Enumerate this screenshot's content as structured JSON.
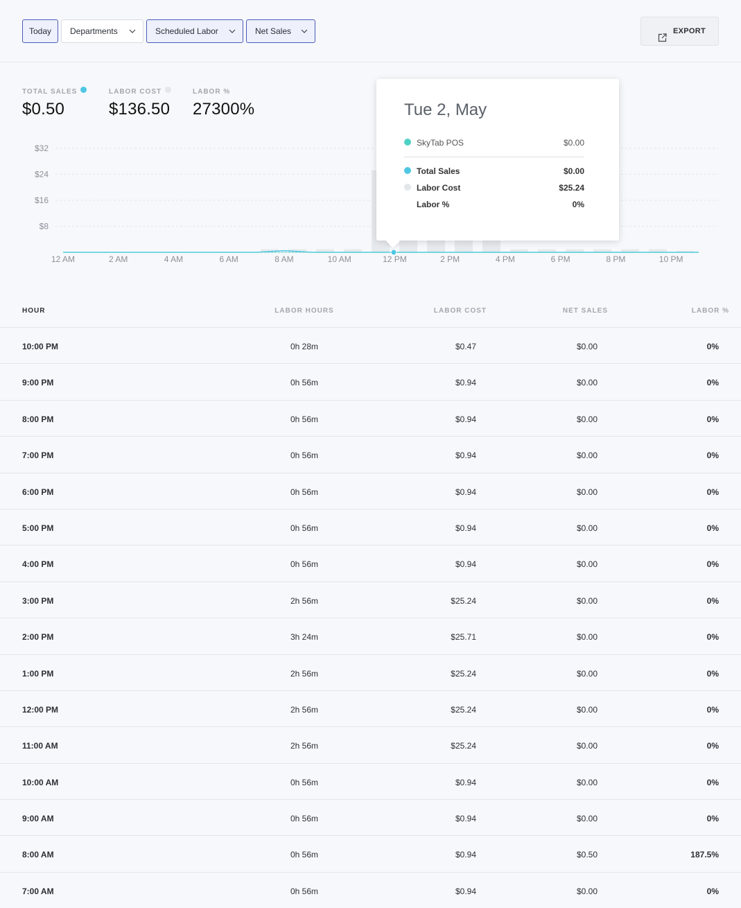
{
  "filters": {
    "today": "Today",
    "departments": "Departments",
    "scheduled_labor": "Scheduled Labor",
    "net_sales": "Net Sales"
  },
  "export_label": "EXPORT",
  "stats": {
    "total_sales": {
      "label": "TOTAL SALES",
      "value": "$0.50",
      "dot_color": "#4fc7e4"
    },
    "labor_cost": {
      "label": "LABOR COST",
      "value": "$136.50",
      "dot_color": "#e3e6ea"
    },
    "labor_pct": {
      "label": "LABOR %",
      "value": "27300%"
    }
  },
  "chart_data": {
    "type": "bar",
    "ylim": [
      0,
      32
    ],
    "ytick_labels": [
      "$32",
      "$24",
      "$16",
      "$8"
    ],
    "yticks": [
      32,
      24,
      16,
      8
    ],
    "xtick_labels": [
      "12 AM",
      "2 AM",
      "4 AM",
      "6 AM",
      "8 AM",
      "10 AM",
      "12 PM",
      "2 PM",
      "4 PM",
      "6 PM",
      "8 PM",
      "10 PM"
    ],
    "hours": [
      0,
      1,
      2,
      3,
      4,
      5,
      6,
      7,
      8,
      9,
      10,
      11,
      12,
      13,
      14,
      15,
      16,
      17,
      18,
      19,
      20,
      21,
      22,
      23
    ],
    "series": [
      {
        "name": "Labor Cost",
        "color": "#e6e9ed",
        "values": [
          0,
          0,
          0,
          0,
          0,
          0,
          0,
          0.94,
          0.94,
          0.94,
          0.94,
          25.24,
          25.24,
          25.24,
          25.71,
          25.24,
          0.94,
          0.94,
          0.94,
          0.94,
          0.94,
          0.94,
          0.47,
          0
        ]
      },
      {
        "name": "Total Sales",
        "color": "#4fc7e4",
        "values": [
          0,
          0,
          0,
          0,
          0,
          0,
          0,
          0,
          0.5,
          0,
          0,
          0,
          0,
          0,
          0,
          0,
          0,
          0,
          0,
          0,
          0,
          0,
          0,
          0
        ]
      }
    ],
    "highlight_hour": 12,
    "grid": true
  },
  "tooltip": {
    "date": "Tue 2, May",
    "rows": [
      {
        "name": "SkyTab POS",
        "value": "$0.00",
        "color": "#4fd1c5"
      },
      {
        "name": "Total Sales",
        "value": "$0.00",
        "color": "#4fc7e4"
      },
      {
        "name": "Labor Cost",
        "value": "$25.24",
        "color": "#e3e6ea"
      },
      {
        "name": "Labor %",
        "value": "0%"
      }
    ]
  },
  "table": {
    "headers": [
      "HOUR",
      "LABOR HOURS",
      "LABOR COST",
      "NET SALES",
      "LABOR %"
    ],
    "rows": [
      [
        "10:00 PM",
        "0h 28m",
        "$0.47",
        "$0.00",
        "0%"
      ],
      [
        "9:00 PM",
        "0h 56m",
        "$0.94",
        "$0.00",
        "0%"
      ],
      [
        "8:00 PM",
        "0h 56m",
        "$0.94",
        "$0.00",
        "0%"
      ],
      [
        "7:00 PM",
        "0h 56m",
        "$0.94",
        "$0.00",
        "0%"
      ],
      [
        "6:00 PM",
        "0h 56m",
        "$0.94",
        "$0.00",
        "0%"
      ],
      [
        "5:00 PM",
        "0h 56m",
        "$0.94",
        "$0.00",
        "0%"
      ],
      [
        "4:00 PM",
        "0h 56m",
        "$0.94",
        "$0.00",
        "0%"
      ],
      [
        "3:00 PM",
        "2h 56m",
        "$25.24",
        "$0.00",
        "0%"
      ],
      [
        "2:00 PM",
        "3h 24m",
        "$25.71",
        "$0.00",
        "0%"
      ],
      [
        "1:00 PM",
        "2h 56m",
        "$25.24",
        "$0.00",
        "0%"
      ],
      [
        "12:00 PM",
        "2h 56m",
        "$25.24",
        "$0.00",
        "0%"
      ],
      [
        "11:00 AM",
        "2h 56m",
        "$25.24",
        "$0.00",
        "0%"
      ],
      [
        "10:00 AM",
        "0h 56m",
        "$0.94",
        "$0.00",
        "0%"
      ],
      [
        "9:00 AM",
        "0h 56m",
        "$0.94",
        "$0.00",
        "0%"
      ],
      [
        "8:00 AM",
        "0h 56m",
        "$0.94",
        "$0.50",
        "187.5%"
      ],
      [
        "7:00 AM",
        "0h 56m",
        "$0.94",
        "$0.00",
        "0%"
      ]
    ]
  }
}
